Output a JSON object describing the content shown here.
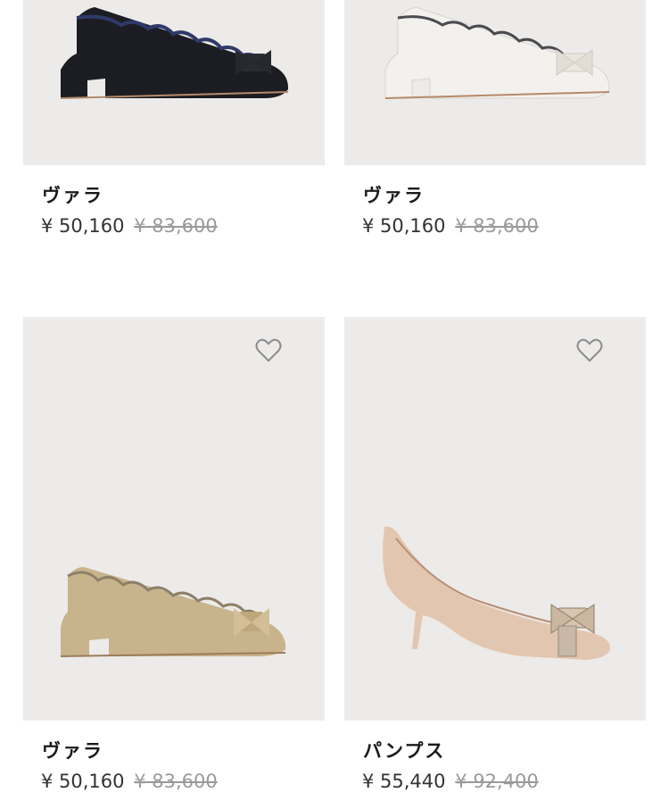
{
  "products": [
    {
      "name": "ヴァラ",
      "price": "¥ 50,160",
      "original_price": "¥ 83,600",
      "color": "black",
      "icon": "heart-icon"
    },
    {
      "name": "ヴァラ",
      "price": "¥ 50,160",
      "original_price": "¥ 83,600",
      "color": "white",
      "icon": "heart-icon"
    },
    {
      "name": "ヴァラ",
      "price": "¥ 50,160",
      "original_price": "¥ 83,600",
      "color": "gold",
      "icon": "heart-icon"
    },
    {
      "name": "パンプス",
      "price": "¥ 55,440",
      "original_price": "¥ 92,400",
      "color": "nude",
      "icon": "heart-icon"
    }
  ],
  "colors": {
    "image_bg": "#ecebe9",
    "strike": "#9a9a9a"
  }
}
